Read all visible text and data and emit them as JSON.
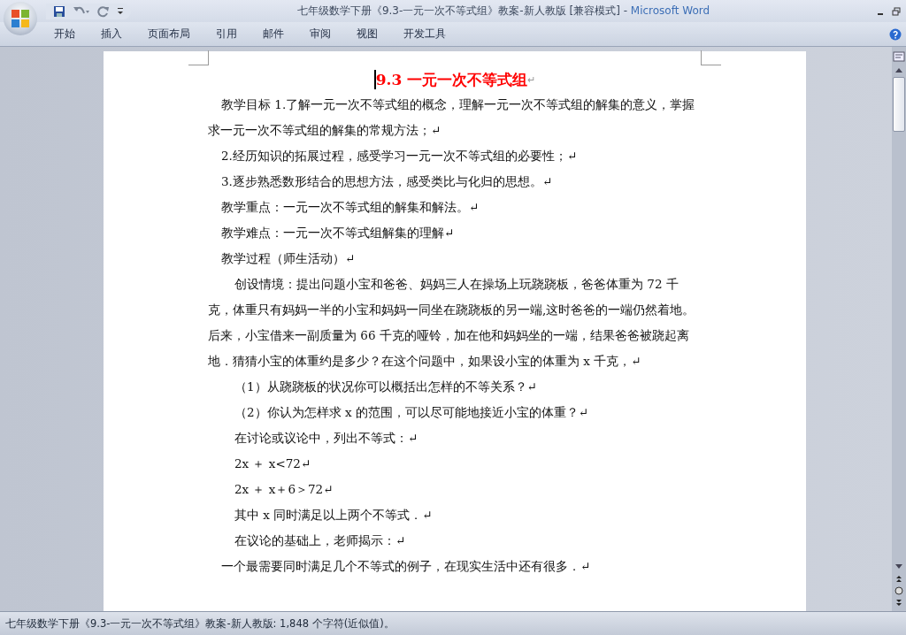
{
  "window": {
    "title_doc": "七年级数学下册《9.3-一元一次不等式组》教案-新人教版 [兼容模式]",
    "title_sep": " - ",
    "title_app": "Microsoft Word"
  },
  "tabs": [
    {
      "label": "开始",
      "selected": false
    },
    {
      "label": "插入",
      "selected": false
    },
    {
      "label": "页面布局",
      "selected": false
    },
    {
      "label": "引用",
      "selected": false
    },
    {
      "label": "邮件",
      "selected": false
    },
    {
      "label": "审阅",
      "selected": false
    },
    {
      "label": "视图",
      "selected": false
    },
    {
      "label": "开发工具",
      "selected": false
    }
  ],
  "document": {
    "title": "9.3  一元一次不等式组",
    "title_mark": "↵",
    "paragraphs": [
      {
        "kind": "first",
        "text": "教学目标 1.了解一元一次不等式组的概念，理解一元一次不等式组的解集的意义，掌握求一元一次不等式组的解集的常规方法；↵"
      },
      {
        "kind": "first",
        "text": "2.经历知识的拓展过程，感受学习一元一次不等式组的必要性；↵"
      },
      {
        "kind": "first",
        "text": "3.逐步熟悉数形结合的思想方法，感受类比与化归的思想。↵"
      },
      {
        "kind": "first",
        "text": "教学重点：一元一次不等式组的解集和解法。↵"
      },
      {
        "kind": "first",
        "text": "教学难点：一元一次不等式组解集的理解↵"
      },
      {
        "kind": "first",
        "text": "教学过程（师生活动）↵"
      },
      {
        "kind": "double",
        "text": "创设情境：提出问题小宝和爸爸、妈妈三人在操场上玩跷跷板，爸爸体重为 72 千克，体重只有妈妈一半的小宝和妈妈一同坐在跷跷板的另一端,这时爸爸的一端仍然着地。后来，小宝借来一副质量为 66 千克的哑铃，加在他和妈妈坐的一端，结果爸爸被跷起离地．猜猜小宝的体重约是多少？在这个问题中，如果设小宝的体重为 x 千克，↵"
      },
      {
        "kind": "double",
        "text": "（1）从跷跷板的状况你可以概括出怎样的不等关系？↵"
      },
      {
        "kind": "double",
        "text": "（2）你认为怎样求 x 的范围，可以尽可能地接近小宝的体重？↵"
      },
      {
        "kind": "double",
        "text": "在讨论或议论中，列出不等式：↵"
      },
      {
        "kind": "double",
        "text": "2x ＋ x<72↵"
      },
      {
        "kind": "double",
        "text": "2x ＋ x＋6＞72↵"
      },
      {
        "kind": "double",
        "text": "其中 x 同时满足以上两个不等式．↵"
      },
      {
        "kind": "double",
        "text": "在议论的基础上，老师揭示：↵"
      },
      {
        "kind": "first",
        "text": "一个最需要同时满足几个不等式的例子，在现实生活中还有很多．↵"
      }
    ]
  },
  "status_bar": {
    "text": "七年级数学下册《9.3-一元一次不等式组》教案-新人教版: 1,848 个字符(近似值)。"
  }
}
